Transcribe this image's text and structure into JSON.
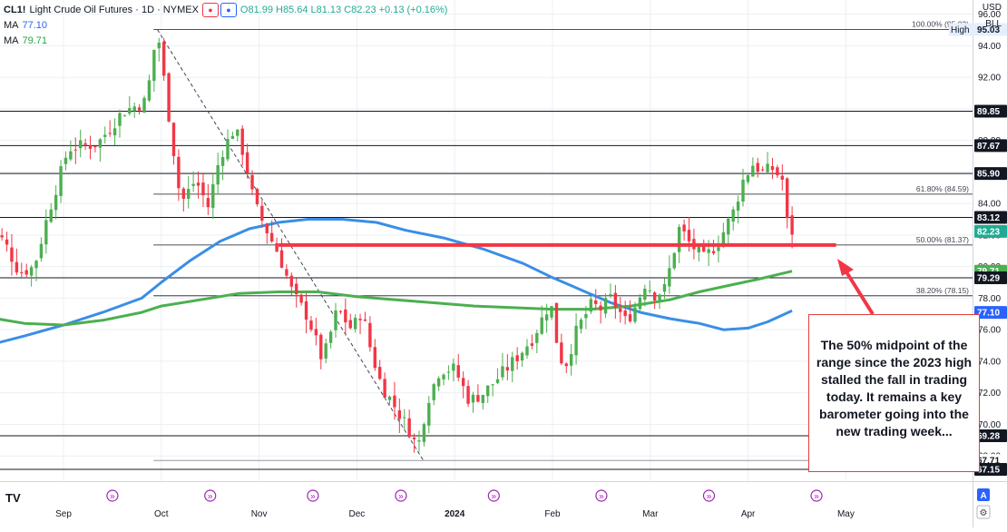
{
  "header": {
    "symbol": "CL1!",
    "title": "Light Crude Oil Futures · 1D · NYMEX",
    "ohlc": {
      "o": "O81.99",
      "h": "H85.64",
      "l": "L81.13",
      "c": "C82.23",
      "chg": "+0.13 (+0.16%)"
    },
    "ma_label": "MA",
    "ma1_value": "77.10",
    "ma2_value": "79.71",
    "currency": "USD",
    "unit": "BLL"
  },
  "colors": {
    "up": "#4caf50",
    "down": "#f23645",
    "ma_fast": "#3a8ee6",
    "ma_slow": "#4caf50",
    "support": "#f23645",
    "level_line": "#131722",
    "grid": "#eceff3",
    "fib_line": "#131722"
  },
  "chart_data": {
    "type": "line",
    "title": "Light Crude Oil Futures",
    "xlabel": "",
    "ylabel": "",
    "ylim": [
      66.4,
      96.9
    ],
    "x_ticks": [
      "Sep",
      "Oct",
      "Nov",
      "Dec",
      "2024",
      "Feb",
      "Mar",
      "Apr",
      "May"
    ],
    "x_tick_pos": [
      0,
      1,
      2,
      3,
      4,
      5,
      6,
      7,
      8
    ],
    "y_ticks": [
      96,
      94,
      92,
      90,
      88,
      86,
      84,
      82,
      80,
      78,
      76,
      74,
      72,
      70,
      68
    ],
    "fib_levels": [
      {
        "label": "100.00% (95.03)",
        "price": 95.03
      },
      {
        "label": "61.80% (84.59)",
        "price": 84.59
      },
      {
        "label": "50.00% (81.37)",
        "price": 81.37
      },
      {
        "label": "38.20% (78.15)",
        "price": 78.15
      }
    ],
    "price_levels": [
      {
        "value": "95.03",
        "price": 95.03,
        "style": "high",
        "label": "High"
      },
      {
        "value": "89.85",
        "price": 89.85,
        "style": "line"
      },
      {
        "value": "87.67",
        "price": 87.67,
        "style": "line"
      },
      {
        "value": "85.90",
        "price": 85.9,
        "style": "line"
      },
      {
        "value": "83.12",
        "price": 83.12,
        "style": "line"
      },
      {
        "value": "82.23",
        "price": 82.23,
        "style": "last"
      },
      {
        "value": "79.71",
        "price": 79.71,
        "style": "ma2"
      },
      {
        "value": "79.29",
        "price": 79.29,
        "style": "line"
      },
      {
        "value": "77.10",
        "price": 77.1,
        "style": "ma1"
      },
      {
        "value": "69.28",
        "price": 69.28,
        "style": "line"
      },
      {
        "value": "67.71",
        "price": 67.71,
        "style": "thin"
      },
      {
        "value": "67.15",
        "price": 67.15,
        "style": "line"
      }
    ],
    "support_line": {
      "price": 81.37
    },
    "series": [
      {
        "name": "MA",
        "color": "#3a8ee6",
        "points": [
          [
            -0.78,
            75.0
          ],
          [
            -0.4,
            75.6
          ],
          [
            0,
            76.3
          ],
          [
            0.4,
            77.1
          ],
          [
            0.8,
            78.0
          ],
          [
            1.0,
            79.0
          ],
          [
            1.3,
            80.4
          ],
          [
            1.6,
            81.6
          ],
          [
            1.9,
            82.4
          ],
          [
            2.2,
            82.8
          ],
          [
            2.5,
            83.0
          ],
          [
            2.85,
            83.0
          ],
          [
            3.2,
            82.8
          ],
          [
            3.5,
            82.3
          ],
          [
            3.9,
            81.8
          ],
          [
            4.3,
            81.1
          ],
          [
            4.7,
            80.2
          ],
          [
            5.0,
            79.3
          ],
          [
            5.3,
            78.5
          ],
          [
            5.6,
            77.7
          ],
          [
            5.9,
            77.1
          ],
          [
            6.2,
            76.7
          ],
          [
            6.5,
            76.4
          ],
          [
            6.75,
            76.0
          ],
          [
            7.0,
            76.1
          ],
          [
            7.2,
            76.5
          ],
          [
            7.45,
            77.2
          ]
        ]
      },
      {
        "name": "MA",
        "color": "#4caf50",
        "points": [
          [
            -0.78,
            76.8
          ],
          [
            -0.4,
            76.4
          ],
          [
            0,
            76.3
          ],
          [
            0.4,
            76.6
          ],
          [
            0.8,
            77.1
          ],
          [
            1.0,
            77.5
          ],
          [
            1.4,
            77.9
          ],
          [
            1.8,
            78.3
          ],
          [
            2.2,
            78.4
          ],
          [
            2.6,
            78.4
          ],
          [
            3.0,
            78.1
          ],
          [
            3.4,
            77.9
          ],
          [
            3.8,
            77.7
          ],
          [
            4.2,
            77.5
          ],
          [
            4.6,
            77.4
          ],
          [
            5.0,
            77.3
          ],
          [
            5.4,
            77.3
          ],
          [
            5.8,
            77.5
          ],
          [
            6.2,
            77.9
          ],
          [
            6.5,
            78.4
          ],
          [
            6.8,
            78.8
          ],
          [
            7.1,
            79.2
          ],
          [
            7.45,
            79.71
          ]
        ]
      }
    ],
    "candle_path": [
      [
        -0.78,
        82.8
      ],
      [
        -0.6,
        81.5
      ],
      [
        -0.45,
        79.6
      ],
      [
        -0.3,
        80.0
      ],
      [
        -0.15,
        83.5
      ],
      [
        0.05,
        87.5
      ],
      [
        0.35,
        87.8
      ],
      [
        0.6,
        89.8
      ],
      [
        0.85,
        90.5
      ],
      [
        0.9,
        92.8
      ],
      [
        0.96,
        95.0
      ],
      [
        1.1,
        88.5
      ],
      [
        1.2,
        84.0
      ],
      [
        1.35,
        85.5
      ],
      [
        1.48,
        83.8
      ],
      [
        1.6,
        87.0
      ],
      [
        1.75,
        88.8
      ],
      [
        1.85,
        87.0
      ],
      [
        1.95,
        84.0
      ],
      [
        2.1,
        82.0
      ],
      [
        2.2,
        80.8
      ],
      [
        2.35,
        78.2
      ],
      [
        2.5,
        76.8
      ],
      [
        2.65,
        74.0
      ],
      [
        2.8,
        77.3
      ],
      [
        2.95,
        76.0
      ],
      [
        3.05,
        77.2
      ],
      [
        3.15,
        74.5
      ],
      [
        3.25,
        72.5
      ],
      [
        3.4,
        71.0
      ],
      [
        3.55,
        69.5
      ],
      [
        3.62,
        68.4
      ],
      [
        3.72,
        71.5
      ],
      [
        3.85,
        73.5
      ],
      [
        4.0,
        73.5
      ],
      [
        4.15,
        71.5
      ],
      [
        4.3,
        72.0
      ],
      [
        4.45,
        73.0
      ],
      [
        4.6,
        74.0
      ],
      [
        4.8,
        75.5
      ],
      [
        4.98,
        77.8
      ],
      [
        5.05,
        75.0
      ],
      [
        5.12,
        73.5
      ],
      [
        5.25,
        76.0
      ],
      [
        5.4,
        77.6
      ],
      [
        5.5,
        77.3
      ],
      [
        5.6,
        78.0
      ],
      [
        5.75,
        76.5
      ],
      [
        5.85,
        77.5
      ],
      [
        5.95,
        79.0
      ],
      [
        6.05,
        78.2
      ],
      [
        6.15,
        78.6
      ],
      [
        6.3,
        82.5
      ],
      [
        6.4,
        81.5
      ],
      [
        6.55,
        80.5
      ],
      [
        6.7,
        81.6
      ],
      [
        6.85,
        83.5
      ],
      [
        6.95,
        85.5
      ],
      [
        7.05,
        86.5
      ],
      [
        7.15,
        86.0
      ],
      [
        7.25,
        86.2
      ],
      [
        7.35,
        85.5
      ],
      [
        7.4,
        82.8
      ],
      [
        7.45,
        82.23
      ]
    ],
    "annotation": "The 50% midpoint of the range since the 2023 high stalled the fall in trading today. It remains a key barometer going into the new trading week..."
  }
}
